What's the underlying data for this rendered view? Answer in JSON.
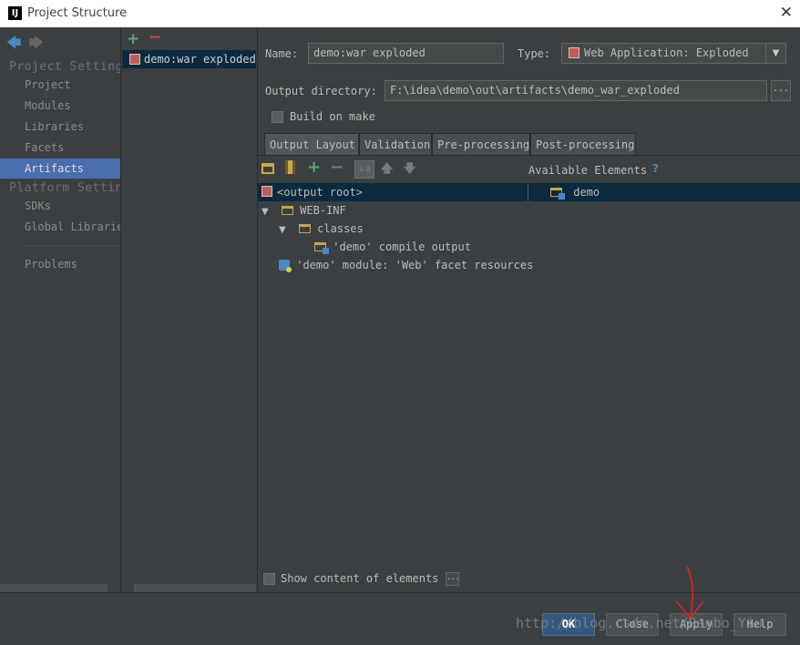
{
  "window": {
    "title": "Project Structure",
    "app_icon": "intellij-logo",
    "app_icon_letter": "IJ",
    "close_glyph": "✕"
  },
  "nav": {
    "back_glyph": "🡄",
    "forward_glyph": "🡆",
    "section_project": "Project Setting",
    "project_items": [
      {
        "label": "Project"
      },
      {
        "label": "Modules"
      },
      {
        "label": "Libraries"
      },
      {
        "label": "Facets"
      },
      {
        "label": "Artifacts",
        "selected": true
      }
    ],
    "section_platform": "Platform Settin",
    "platform_items": [
      {
        "label": "SDKs"
      },
      {
        "label": "Global Librarie"
      }
    ],
    "problems": "Problems"
  },
  "artifacts": {
    "add_glyph": "+",
    "remove_glyph": "−",
    "items": [
      {
        "label": "demo:war exploded",
        "icon": "war-archive-icon"
      }
    ]
  },
  "form": {
    "name_label": "Name:",
    "name_value": "demo:war exploded",
    "type_label": "Type:",
    "type_value": "Web Application: Exploded",
    "output_dir_label": "Output directory:",
    "output_dir_value": "F:\\idea\\demo\\out\\artifacts\\demo_war_exploded",
    "browse_glyph": "...",
    "build_on_make_label": "Build on make",
    "build_on_make_checked": false
  },
  "tabs": [
    {
      "label": "Output Layout",
      "active": true
    },
    {
      "label": "Validation"
    },
    {
      "label": "Pre-processing"
    },
    {
      "label": "Post-processing"
    }
  ],
  "toolbar": {
    "add_glyph": "+",
    "remove_glyph": "−",
    "sort_glyph": "↓a",
    "up_glyph": "🡅",
    "down_glyph": "🡇"
  },
  "layout": {
    "available_elements_label": "Available Elements",
    "help_glyph": "?",
    "output_root": "<output root>",
    "available_items": [
      {
        "label": "demo"
      }
    ],
    "tree": {
      "web_inf": "WEB-INF",
      "classes": "classes",
      "compile_output": "'demo' compile output",
      "facet_resources": "'demo' module: 'Web' facet resources"
    },
    "expand_glyph": "▼",
    "show_content_label": "Show content of elements",
    "show_content_checked": false,
    "more_glyph": "..."
  },
  "buttons": {
    "ok": "OK",
    "close": "Close",
    "apply": "Apply",
    "help": "Help"
  },
  "watermark": "http://blog.csdn.net/Rambo_Yiu",
  "colors": {
    "background": "#3c3f41",
    "selection": "#4b6eaf",
    "tree_selection": "#0d293e",
    "accent_blue": "#4a88c7",
    "add_green": "#59a869",
    "remove_red": "#c75450",
    "annotation_red": "#e02020"
  }
}
